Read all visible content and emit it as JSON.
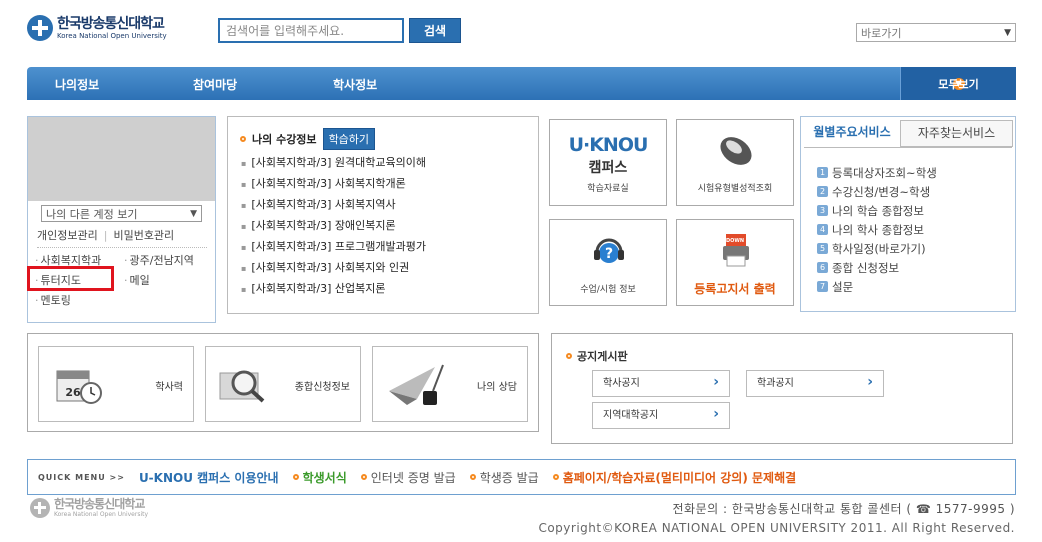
{
  "header": {
    "logo_ko": "한국방송통신대학교",
    "logo_en": "Korea National Open University",
    "search_placeholder": "검색어를 입력해주세요.",
    "search_button": "검색",
    "quick_select": "바로가기"
  },
  "nav": {
    "items": [
      "나의정보",
      "참여마당",
      "학사정보"
    ],
    "all_label": "모두보기"
  },
  "profile": {
    "account_select": "나의 다른 계정 보기",
    "info_manage": "개인정보관리",
    "password_manage": "비밀번호관리",
    "links": [
      "사회복지학과",
      "광주/전남지역",
      "튜터지도",
      "메일",
      "멘토링"
    ]
  },
  "courses": {
    "title": "나의 수강정보",
    "study_button": "학습하기",
    "items": [
      "[사회복지학과/3] 원격대학교육의이해",
      "[사회복지학과/3] 사회복지학개론",
      "[사회복지학과/3] 사회복지역사",
      "[사회복지학과/3] 장애인복지론",
      "[사회복지학과/3] 프로그램개발과평가",
      "[사회복지학과/3] 사회복지와 인권",
      "[사회복지학과/3] 산업복지론"
    ]
  },
  "tiles": {
    "uknou_logo": "U·KNOU",
    "uknou_sub": "캠퍼스",
    "uknou_caption": "학습자료실",
    "exam_caption": "시험유형별성적조회",
    "classinfo_caption": "수업/시험 정보",
    "print_caption": "등록고지서 출력",
    "print_badge": "DOWN"
  },
  "services": {
    "tab_monthly": "월별주요서비스",
    "tab_frequent": "자주찾는서비스",
    "items": [
      {
        "num": "1",
        "label": "등록대상자조회~학생"
      },
      {
        "num": "2",
        "label": "수강신청/변경~학생"
      },
      {
        "num": "3",
        "label": "나의 학습 종합정보"
      },
      {
        "num": "4",
        "label": "나의 학사 종합정보"
      },
      {
        "num": "5",
        "label": "학사일정(바로가기)"
      },
      {
        "num": "6",
        "label": "종합 신청정보"
      },
      {
        "num": "7",
        "label": "설문"
      }
    ]
  },
  "bottom_tiles": {
    "calendar_label": "학사력",
    "calendar_day": "26",
    "apply_label": "종합신청정보",
    "counsel_label": "나의 상담"
  },
  "notice": {
    "title": "공지게시판",
    "buttons": [
      "학사공지",
      "학과공지",
      "지역대학공지"
    ]
  },
  "quick_menu": {
    "label": "QUICK MENU  >>",
    "items": [
      {
        "text": "U-KNOU 캠퍼스 이용안내",
        "color": "#2a6fb0",
        "bold": true,
        "dot": false
      },
      {
        "text": "학생서식",
        "color": "#3a9a2a",
        "bold": true,
        "dot": true
      },
      {
        "text": "인터넷 증명 발급",
        "color": "#555555",
        "bold": false,
        "dot": true
      },
      {
        "text": "학생증 발급",
        "color": "#555555",
        "bold": false,
        "dot": true
      },
      {
        "text": "홈페이지/학습자료(멀티미디어 강의) 문제해결",
        "color": "#e05a10",
        "bold": true,
        "dot": true
      }
    ]
  },
  "footer": {
    "logo_ko": "한국방송통신대학교",
    "logo_en": "Korea National Open University",
    "contact": "전화문의 : 한국방송통신대학교 통합 콜센터 ( ☎ 1577-9995 )",
    "copyright": "Copyright©KOREA NATIONAL OPEN UNIVERSITY 2011. All Right Reserved."
  }
}
